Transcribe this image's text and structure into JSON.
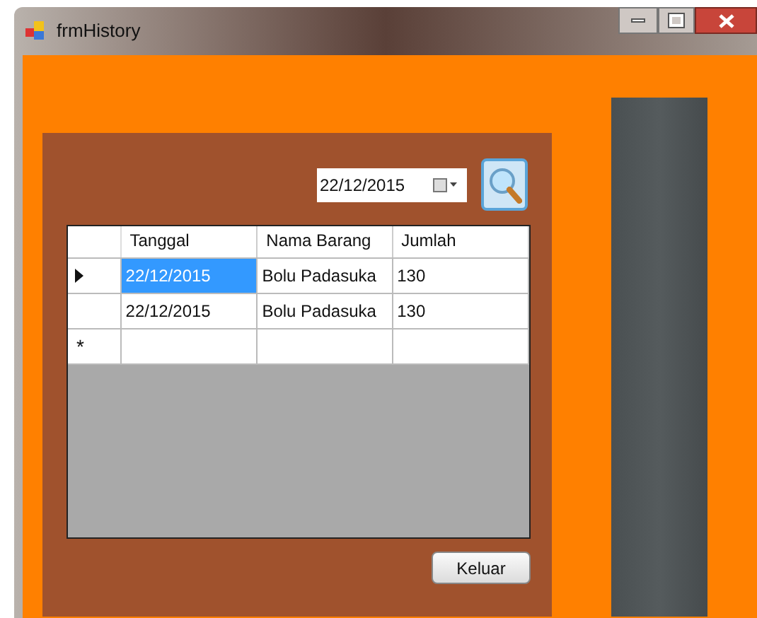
{
  "window": {
    "title": "frmHistory"
  },
  "date_picker": {
    "value": "22/12/2015"
  },
  "table": {
    "columns": [
      "Tanggal",
      "Nama Barang",
      "Jumlah"
    ],
    "rows": [
      {
        "current": true,
        "cells": [
          {
            "text": "22/12/2015",
            "selected": true
          },
          {
            "text": "Bolu Padasuka",
            "selected": false
          },
          {
            "text": "130",
            "selected": false
          }
        ]
      },
      {
        "current": false,
        "cells": [
          {
            "text": "22/12/2015",
            "selected": false
          },
          {
            "text": "Bolu Padasuka",
            "selected": false
          },
          {
            "text": "130",
            "selected": false
          }
        ]
      }
    ],
    "new_row_marker": "*"
  },
  "buttons": {
    "close": "Keluar"
  }
}
